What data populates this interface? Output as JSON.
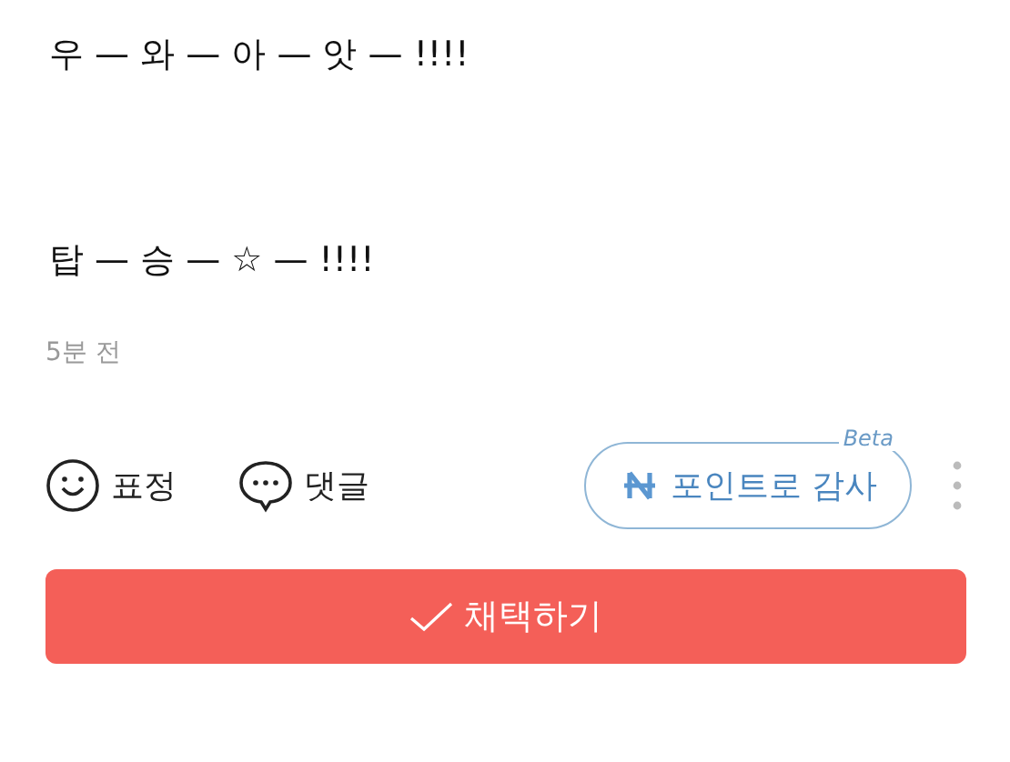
{
  "paragraphs": [
    "우 — 와 — 아 — 앗 — !!!!",
    "탑 — 승 — ☆ — !!!!"
  ],
  "timestamp": "5분 전",
  "actions": [
    {
      "kind": "emoji",
      "label": "표정"
    },
    {
      "kind": "comment",
      "label": "댓글"
    }
  ],
  "thanks_button": {
    "label": "포인트로 감사",
    "badge": "Beta"
  },
  "adopt_button": {
    "label": "채택하기"
  }
}
